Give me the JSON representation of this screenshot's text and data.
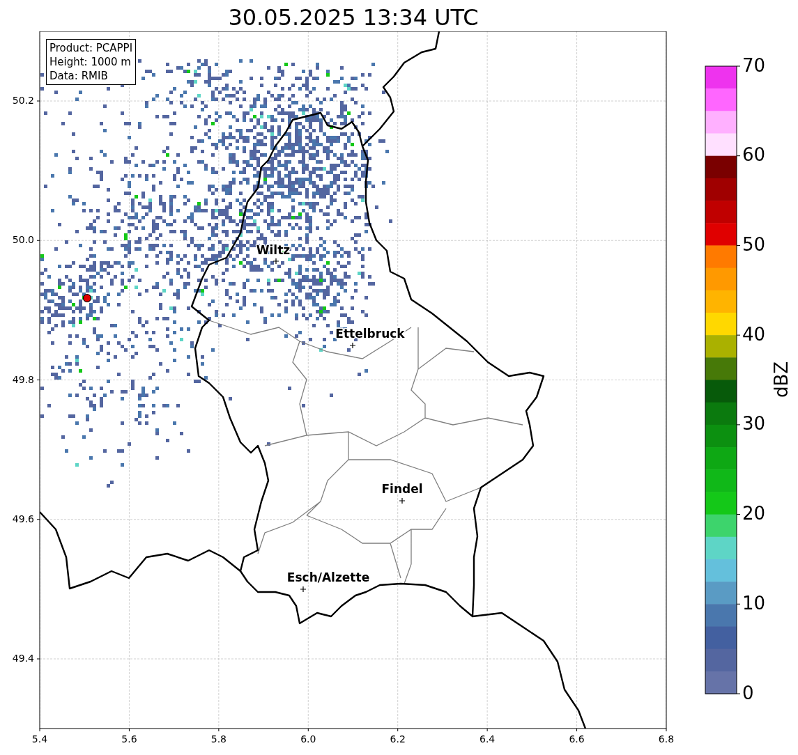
{
  "title": "30.05.2025 13:34 UTC",
  "info_box": [
    "Product: PCAPPI",
    "Height: 1000 m",
    "Data: RMIB"
  ],
  "map": {
    "xticks": [
      "5.4",
      "5.6",
      "5.8",
      "6.0",
      "6.2",
      "6.4",
      "6.6",
      "6.8"
    ],
    "yticks": [
      "50.2",
      "50.0",
      "49.8",
      "49.6",
      "49.4"
    ],
    "cities": [
      {
        "name": "Wiltz"
      },
      {
        "name": "Ettelbruck"
      },
      {
        "name": "Findel"
      },
      {
        "name": "Esch/Alzette"
      }
    ]
  },
  "colorbar": {
    "label": "dBZ",
    "ticks": [
      "70",
      "60",
      "50",
      "40",
      "30",
      "20",
      "10",
      "0"
    ],
    "bins": [
      {
        "color": "#ee33ee"
      },
      {
        "color": "#ff66ff"
      },
      {
        "color": "#ffb0ff"
      },
      {
        "color": "#ffe0ff"
      },
      {
        "color": "#7a0000"
      },
      {
        "color": "#a00000"
      },
      {
        "color": "#c00000"
      },
      {
        "color": "#e00000"
      },
      {
        "color": "#ff7a00"
      },
      {
        "color": "#ff9900"
      },
      {
        "color": "#ffb400"
      },
      {
        "color": "#ffd800"
      },
      {
        "color": "#aab100"
      },
      {
        "color": "#477908"
      },
      {
        "color": "#075a0a"
      },
      {
        "color": "#0b7a0e"
      },
      {
        "color": "#0c9010"
      },
      {
        "color": "#0ea814"
      },
      {
        "color": "#10b818"
      },
      {
        "color": "#14c818"
      },
      {
        "color": "#3dd46c"
      },
      {
        "color": "#5ed5c6"
      },
      {
        "color": "#64c0dc"
      },
      {
        "color": "#5a9bc4"
      },
      {
        "color": "#4a77ad"
      },
      {
        "color": "#4360a0"
      },
      {
        "color": "#5466a0"
      },
      {
        "color": "#6673a8"
      }
    ]
  }
}
